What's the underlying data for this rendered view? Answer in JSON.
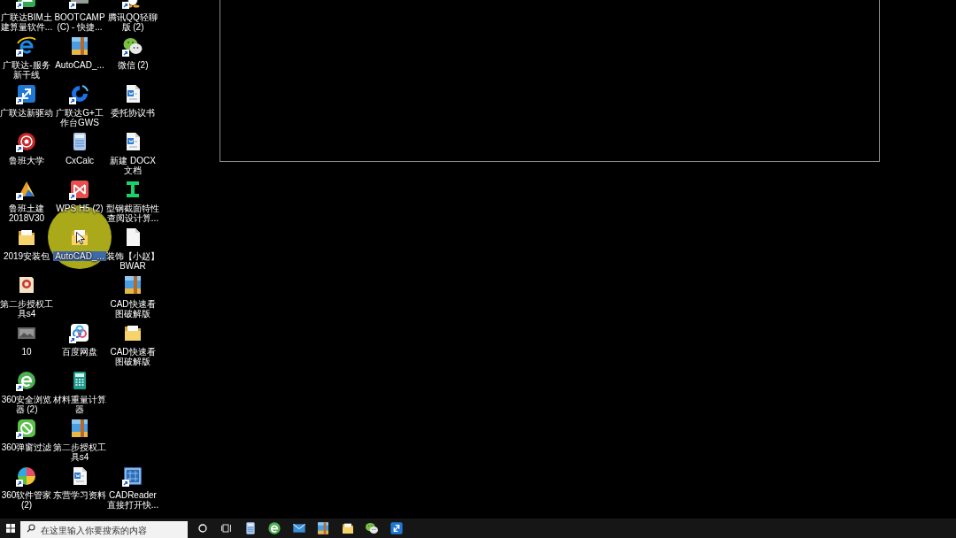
{
  "desktop": {
    "rows": [
      [
        {
          "label": "广联达BIM土建算量软件...",
          "kind": "green-app",
          "shortcut": true,
          "selected": false
        },
        {
          "label": "BOOTCAMP (C) - 快捷...",
          "kind": "drive",
          "shortcut": true,
          "selected": false
        },
        {
          "label": "腾讯QQ轻聊版 (2)",
          "kind": "penguin",
          "shortcut": true,
          "selected": false
        }
      ],
      [
        {
          "label": "广联达-服务新干线",
          "kind": "browser-blue",
          "shortcut": true,
          "selected": false
        },
        {
          "label": "AutoCAD_...",
          "kind": "archive",
          "shortcut": false,
          "selected": false
        },
        {
          "label": "微信 (2)",
          "kind": "chat",
          "shortcut": true,
          "selected": false
        }
      ],
      [
        {
          "label": "广联达新驱动",
          "kind": "blue-tile",
          "shortcut": true,
          "selected": false
        },
        {
          "label": "广联达G+工作台GWS",
          "kind": "swirl",
          "shortcut": true,
          "selected": false
        },
        {
          "label": "委托协议书",
          "kind": "document",
          "shortcut": false,
          "selected": false
        }
      ],
      [
        {
          "label": "鲁班大学",
          "kind": "red-badge",
          "shortcut": true,
          "selected": false
        },
        {
          "label": "CxCalc",
          "kind": "phone",
          "shortcut": false,
          "selected": false
        },
        {
          "label": "新建 DOCX 文档",
          "kind": "document",
          "shortcut": false,
          "selected": false
        }
      ],
      [
        {
          "label": "鲁班土建 2018V30",
          "kind": "pyramid",
          "shortcut": true,
          "selected": false
        },
        {
          "label": "WPS H5 (2)",
          "kind": "red-tile",
          "shortcut": true,
          "selected": false
        },
        {
          "label": "型钢截面特性查阅设计算...",
          "kind": "ibeam",
          "shortcut": false,
          "selected": false
        }
      ],
      [
        {
          "label": "2019安装包",
          "kind": "folder",
          "shortcut": false,
          "selected": false
        },
        {
          "label": "AutoCAD_...",
          "kind": "folder",
          "shortcut": false,
          "selected": true
        },
        {
          "label": "装饰【小赵】BWAR",
          "kind": "file",
          "shortcut": false,
          "selected": false
        }
      ],
      [
        {
          "label": "第二步授权工具s4",
          "kind": "certificate",
          "shortcut": false,
          "selected": false
        },
        null,
        {
          "label": "CAD快速看图破解版",
          "kind": "archive",
          "shortcut": false,
          "selected": false
        }
      ],
      [
        {
          "label": "10",
          "kind": "thumbnail",
          "shortcut": false,
          "selected": false
        },
        {
          "label": "百度网盘",
          "kind": "cloud",
          "shortcut": true,
          "selected": false
        },
        {
          "label": "CAD快速看图破解版",
          "kind": "folder",
          "shortcut": false,
          "selected": false
        }
      ],
      [
        {
          "label": "360安全浏览器 (2)",
          "kind": "browser-green",
          "shortcut": true,
          "selected": false
        },
        {
          "label": "材料重量计算器",
          "kind": "calculator",
          "shortcut": false,
          "selected": false
        }
      ],
      [
        {
          "label": "360弹窗过滤",
          "kind": "green-tile",
          "shortcut": true,
          "selected": false
        },
        {
          "label": "第二步授权工具s4",
          "kind": "archive",
          "shortcut": false,
          "selected": false
        }
      ],
      [
        {
          "label": "360软件管家 (2)",
          "kind": "petals",
          "shortcut": true,
          "selected": false
        },
        {
          "label": "东营学习资料",
          "kind": "document",
          "shortcut": false,
          "selected": false
        },
        {
          "label": "CADReader直接打开快...",
          "kind": "blue-frame",
          "shortcut": true,
          "selected": false
        }
      ]
    ]
  },
  "taskbar": {
    "search": {
      "placeholder": "在这里输入你要搜索的内容"
    }
  }
}
